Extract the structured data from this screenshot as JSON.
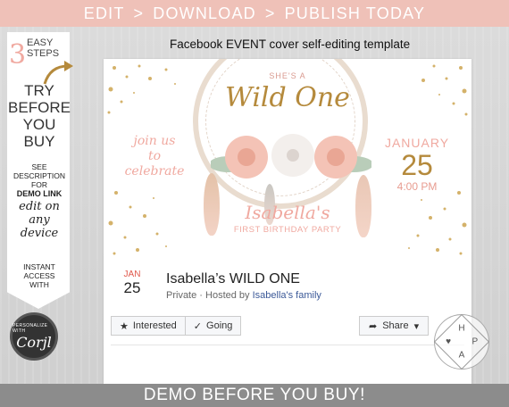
{
  "topbar": {
    "step1": "EDIT",
    "sep": ">",
    "step2": "DOWNLOAD",
    "step3": "PUBLISH TODAY"
  },
  "sidebar": {
    "steps_num": "3",
    "steps_text1": "EASY",
    "steps_text2": "STEPS",
    "try1": "TRY",
    "try2": "BEFORE",
    "try3": "YOU BUY",
    "see1": "SEE",
    "see2": "DESCRIPTION",
    "see3": "FOR",
    "see4": "DEMO LINK",
    "edit1": "edit on",
    "edit2": "any",
    "edit3": "device",
    "instant1": "INSTANT",
    "instant2": "ACCESS",
    "instant3": "WITH",
    "corjl_top": "PERSONALIZE WITH",
    "corjl_name": "Corjl"
  },
  "heading": "Facebook EVENT cover self-editing template",
  "cover": {
    "shes": "SHE'S A",
    "wild": "Wild One",
    "join1": "join us",
    "join2": "to",
    "join3": "celebrate",
    "month": "JANUARY",
    "day": "25",
    "time": "4:00 PM",
    "name": "Isabella's",
    "party": "FIRST BIRTHDAY PARTY"
  },
  "event": {
    "month": "JAN",
    "day": "25",
    "title": "Isabella’s WILD ONE",
    "privacy": "Private · Hosted by ",
    "host": "Isabella's family",
    "interested": "Interested",
    "going": "Going",
    "share": "Share"
  },
  "logo": {
    "h": "H",
    "p": "P",
    "a": "A",
    "heart": "♥"
  },
  "bottombar": "DEMO BEFORE YOU BUY!",
  "colors": {
    "blush": "#efc1b8",
    "pink": "#f0a9a0",
    "gold": "#b58a3c",
    "gray": "#8c8c8c",
    "fb_blue": "#3b5998"
  }
}
